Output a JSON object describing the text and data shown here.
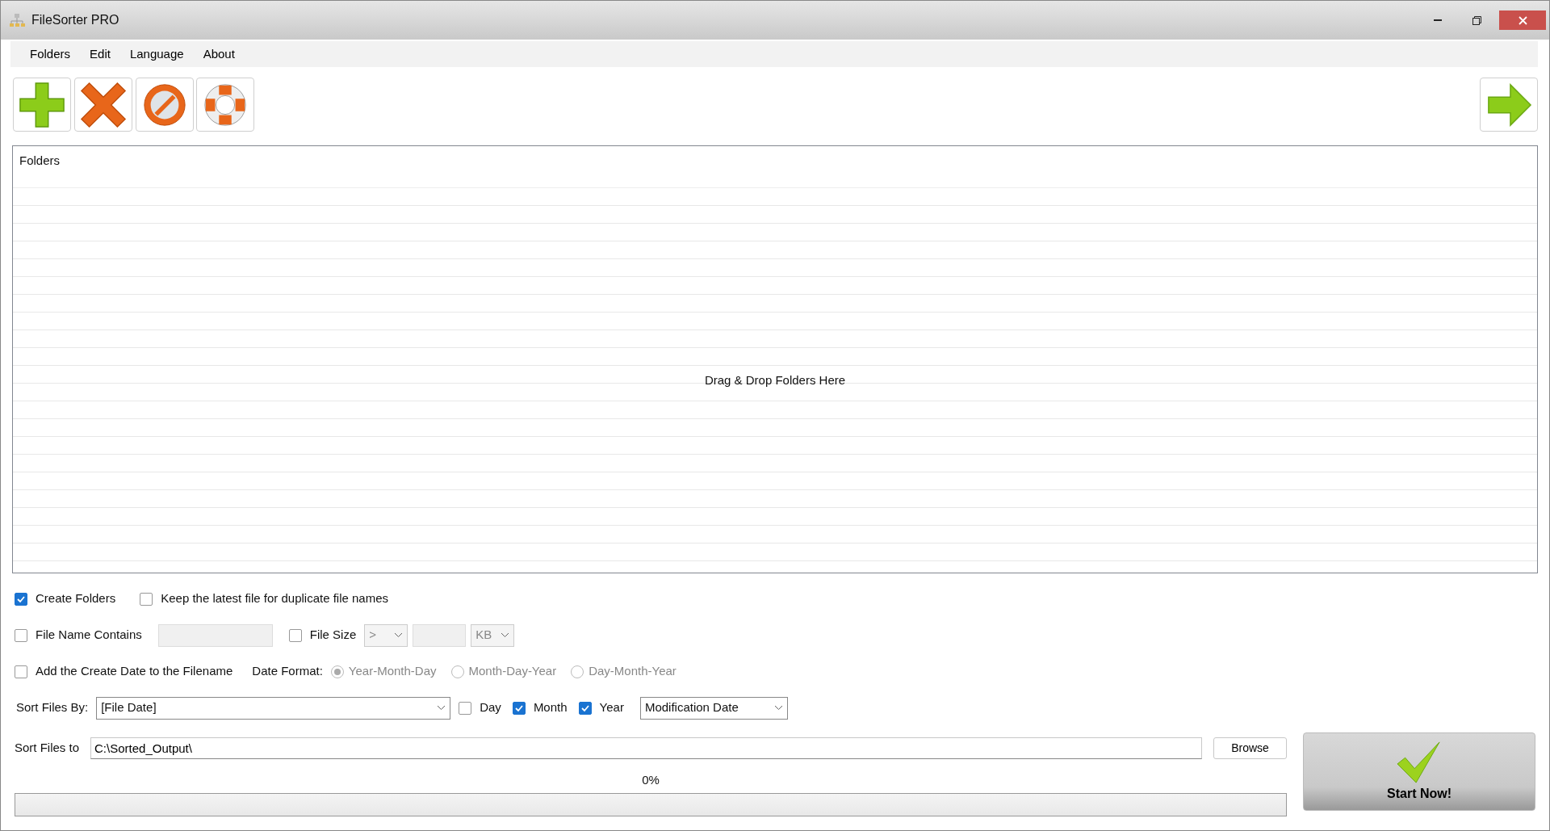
{
  "window": {
    "title": "FileSorter PRO"
  },
  "menu": [
    {
      "label": "Folders"
    },
    {
      "label": "Edit"
    },
    {
      "label": "Language"
    },
    {
      "label": "About"
    }
  ],
  "toolbar": [
    {
      "kind": "add"
    },
    {
      "kind": "delete"
    },
    {
      "kind": "cancel"
    },
    {
      "kind": "help"
    }
  ],
  "run_button": {
    "kind": "arrow"
  },
  "folder_list": {
    "header": "Folders",
    "placeholder": "Drag & Drop Folders Here"
  },
  "options": {
    "create_folders": {
      "label": "Create Folders",
      "checked": true
    },
    "keep_latest": {
      "label": "Keep the latest file for duplicate file names",
      "checked": false
    },
    "file_name_contains": {
      "label": "File Name Contains",
      "checked": false,
      "field_disabled": true
    },
    "file_size": {
      "label": "File Size",
      "checked": false,
      "operator": ">",
      "unit": "KB",
      "disabled": true
    },
    "add_create_date": {
      "label": "Add the Create Date to the Filename",
      "checked": false
    },
    "date_format": {
      "label": "Date Format:",
      "disabled": true,
      "choices": [
        {
          "label": "Year-Month-Day",
          "selected": true
        },
        {
          "label": "Month-Day-Year",
          "selected": false
        },
        {
          "label": "Day-Month-Year",
          "selected": false
        }
      ]
    },
    "sort_by": {
      "label": "Sort Files By:",
      "value": "[File Date]",
      "parts": [
        {
          "label": "Day",
          "checked": false
        },
        {
          "label": "Month",
          "checked": true
        },
        {
          "label": "Year",
          "checked": true
        }
      ],
      "date_type": "Modification Date"
    },
    "sort_to": {
      "label": "Sort Files to",
      "value": "C:\\Sorted_Output\\",
      "button": "Browse"
    }
  },
  "progress": {
    "label": "0%",
    "level": 0
  },
  "start_button": {
    "label": "Start Now!"
  }
}
